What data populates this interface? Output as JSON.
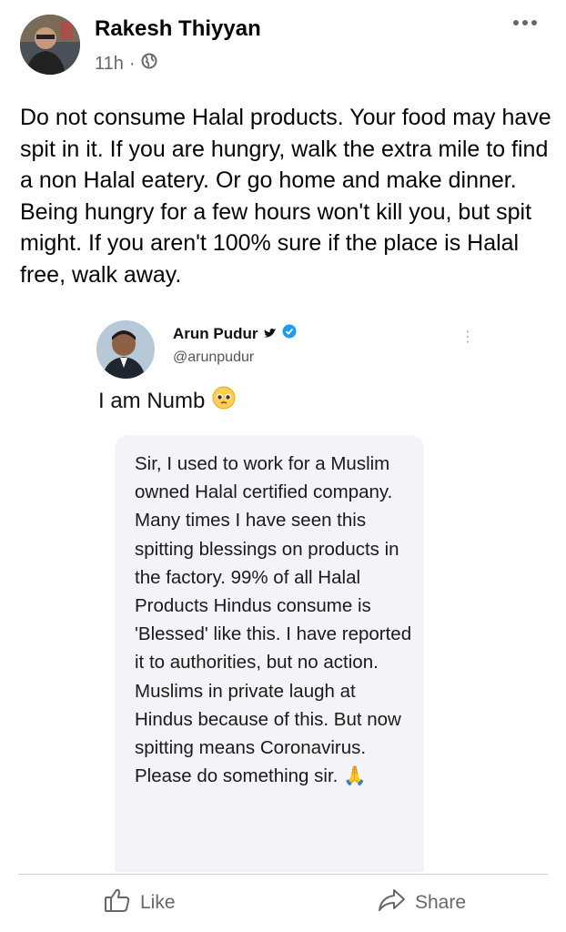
{
  "post": {
    "author": "Rakesh Thiyyan",
    "time": "11h",
    "separator": "·",
    "privacy_icon": "globe-icon",
    "body": "Do not consume Halal products. Your food may have spit in it. If you are hungry, walk the extra mile to find a non Halal eatery. Or go home and make dinner. Being hungry for a few hours won't kill you, but spit might. If you aren't 100% sure if the place is Halal free, walk away."
  },
  "tweet": {
    "name": "Arun Pudur",
    "handle": "@arunpudur",
    "text": "I am Numb",
    "emoji": "🥺",
    "verified_color": "#1d9bf0",
    "reply": "Sir, I used to work for a Muslim owned Halal certified company. Many times I have seen this spitting blessings on products in the factory. 99% of all Halal Products Hindus consume is 'Blessed' like this. I have reported it to authorities, but no action. Muslims in private laugh at Hindus because of this. But now spitting means Coronavirus. Please do something sir. 🙏"
  },
  "actions": {
    "like": "Like",
    "share": "Share"
  },
  "colors": {
    "text": "#050505",
    "secondary": "#65676b",
    "reply_bg": "#f4f3f8"
  }
}
